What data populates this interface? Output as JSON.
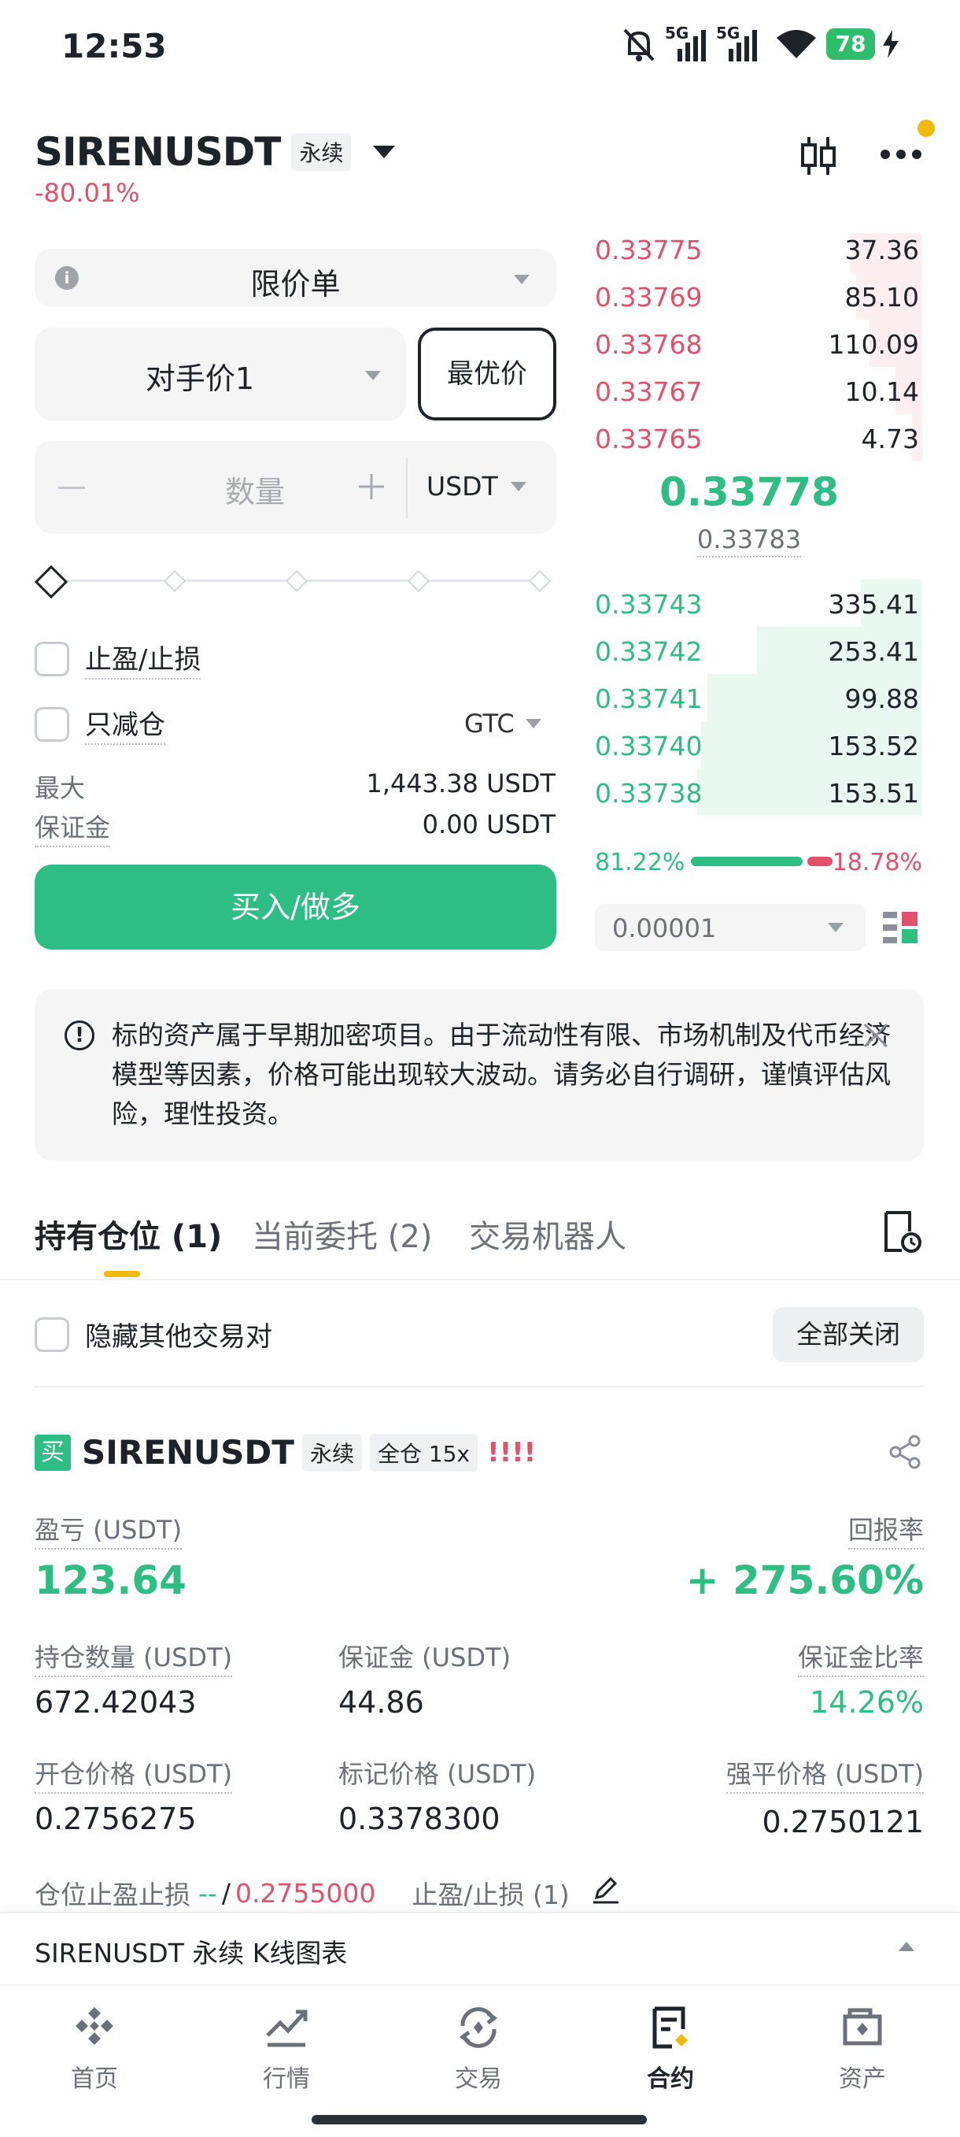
{
  "status_bar": {
    "time": "12:53",
    "network": "5G",
    "battery": "78"
  },
  "header": {
    "symbol": "SIRENUSDT",
    "contract_type": "永续",
    "change": "-80.01%"
  },
  "order_form": {
    "order_type": "限价单",
    "price_mode": "对手价1",
    "best_price_label": "最优价",
    "quantity_placeholder": "数量",
    "unit": "USDT",
    "tp_sl_label": "止盈/止损",
    "reduce_only_label": "只减仓",
    "tif": "GTC",
    "max_label": "最大",
    "max_value": "1,443.38 USDT",
    "margin_label": "保证金",
    "margin_value": "0.00 USDT",
    "buy_button": "买入/做多"
  },
  "orderbook": {
    "asks": [
      {
        "price": "0.33775",
        "qty": "37.36",
        "depth": 0.22
      },
      {
        "price": "0.33769",
        "qty": "85.10",
        "depth": 0.2
      },
      {
        "price": "0.33768",
        "qty": "110.09",
        "depth": 0.16
      },
      {
        "price": "0.33767",
        "qty": "10.14",
        "depth": 0.08
      },
      {
        "price": "0.33765",
        "qty": "4.73",
        "depth": 0.03
      }
    ],
    "last_price": "0.33778",
    "mark_price": "0.33783",
    "bids": [
      {
        "price": "0.33743",
        "qty": "335.41",
        "depth": 0.185
      },
      {
        "price": "0.33742",
        "qty": "253.41",
        "depth": 0.5
      },
      {
        "price": "0.33741",
        "qty": "99.88",
        "depth": 0.65
      },
      {
        "price": "0.33740",
        "qty": "153.52",
        "depth": 0.67
      },
      {
        "price": "0.33738",
        "qty": "153.51",
        "depth": 0.68
      }
    ],
    "buy_ratio": "81.22%",
    "sell_ratio": "18.78%",
    "buy_fraction": 0.8122,
    "precision": "0.00001"
  },
  "notice": {
    "text": "标的资产属于早期加密项目。由于流动性有限、市场机制及代币经济模型等因素，价格可能出现较大波动。请务必自行调研，谨慎评估风险，理性投资。"
  },
  "tabs": [
    {
      "label": "持有仓位 (1)",
      "active": true
    },
    {
      "label": "当前委托 (2)",
      "active": false
    },
    {
      "label": "交易机器人",
      "active": false
    }
  ],
  "positions_bar": {
    "hide_label": "隐藏其他交易对",
    "close_all": "全部关闭"
  },
  "position": {
    "side": "买",
    "symbol": "SIRENUSDT",
    "type": "永续",
    "margin_mode": "全仓 15x",
    "risk": "!!!!",
    "pnl_label": "盈亏 (USDT)",
    "pnl": "123.64",
    "roe_label": "回报率",
    "roe": "+ 275.60%",
    "size_label": "持仓数量 (USDT)",
    "size": "672.42043",
    "margin_label": "保证金 (USDT)",
    "margin": "44.86",
    "margin_ratio_label": "保证金比率",
    "margin_ratio": "14.26%",
    "entry_label": "开仓价格 (USDT)",
    "entry": "0.2756275",
    "mark_label": "标记价格 (USDT)",
    "mark": "0.3378300",
    "liq_label": "强平价格 (USDT)",
    "liq": "0.2750121",
    "tpsl_label": "仓位止盈止损",
    "tp_value": "--",
    "sep": "/",
    "sl_value": "0.2755000",
    "tpsl_orders": "止盈/止损 (1)"
  },
  "kline_bar": {
    "label": "SIRENUSDT 永续 K线图表"
  },
  "bottom_nav": [
    {
      "label": "首页",
      "icon": "home-icon"
    },
    {
      "label": "行情",
      "icon": "chart-icon"
    },
    {
      "label": "交易",
      "icon": "trade-icon"
    },
    {
      "label": "合约",
      "icon": "futures-icon"
    },
    {
      "label": "资产",
      "icon": "wallet-icon"
    }
  ],
  "colors": {
    "green": "#2ebd85",
    "red": "#e0516b",
    "accent": "#f0b90b"
  }
}
